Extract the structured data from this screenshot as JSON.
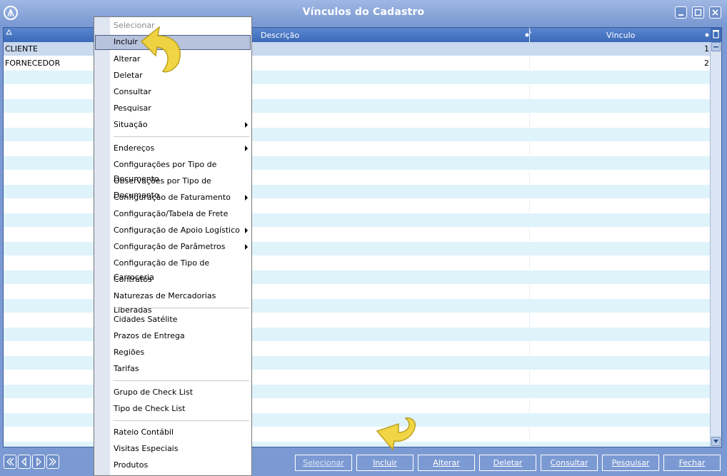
{
  "window": {
    "title": "Vínculos do Cadastro"
  },
  "grid": {
    "columns": [
      "Descrição",
      "Vínculo"
    ],
    "rows": [
      {
        "col1": "CLIENTE",
        "col3": "1"
      },
      {
        "col1": "FORNECEDOR",
        "col3": "2"
      }
    ]
  },
  "menu": {
    "items": [
      {
        "label": "Selecionar",
        "disabled": true
      },
      {
        "label": "Incluir"
      },
      {
        "label": "Alterar"
      },
      {
        "label": "Deletar"
      },
      {
        "label": "Consultar"
      },
      {
        "label": "Pesquisar"
      },
      {
        "label": "Situação",
        "submenu": true
      },
      {
        "label": "Endereços",
        "submenu": true
      },
      {
        "label": "Configurações por Tipo de Documento"
      },
      {
        "label": "Observações por Tipo de Documento"
      },
      {
        "label": "Configuração de Faturamento",
        "submenu": true
      },
      {
        "label": "Configuração/Tabela de Frete"
      },
      {
        "label": "Configuração de Apoio Logístico",
        "submenu": true
      },
      {
        "label": "Configuração de Parâmetros",
        "submenu": true
      },
      {
        "label": "Configuração de Tipo de Carroceria"
      },
      {
        "label": "Contratos"
      },
      {
        "label": "Naturezas de Mercadorias Liberadas"
      },
      {
        "label": "Cidades Satélite"
      },
      {
        "label": "Prazos de Entrega"
      },
      {
        "label": "Regiões"
      },
      {
        "label": "Tarifas"
      },
      {
        "label": "Grupo de Check List"
      },
      {
        "label": "Tipo de Check List"
      },
      {
        "label": "Rateio Contábil"
      },
      {
        "label": "Visitas Especiais"
      },
      {
        "label": "Produtos"
      }
    ]
  },
  "buttons": {
    "selecionar": "Selecionar",
    "incluir": "Incluir",
    "alterar": "Alterar",
    "deletar": "Deletar",
    "consultar": "Consultar",
    "pesquisar": "Pesquisar",
    "fechar": "Fechar"
  },
  "colors": {
    "accent": "#7b9ad3",
    "header": "#3c6ab8",
    "row_alt": "#dff3fb",
    "highlight_arrow": "#f2d33a"
  }
}
